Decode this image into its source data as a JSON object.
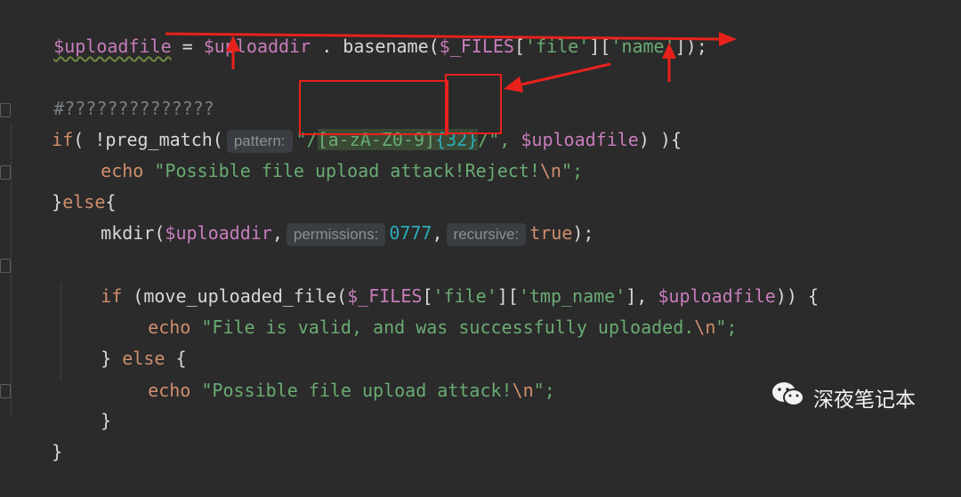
{
  "code": {
    "l1": {
      "var1": "$uploadfile",
      "eq": " = ",
      "var2": "$uploaddir",
      "dot": " . basename(",
      "var3": "$_FILES",
      "b1": "[",
      "s1": "'file'",
      "b2": "][",
      "s2": "'name'",
      "b3": "]);"
    },
    "l2": {
      "comment": "#??????????????"
    },
    "l3": {
      "kw": "if",
      "p1": "( !preg_match(",
      "hint": "pattern:",
      "q1": "\"/",
      "regex": "[a-zA-Z0-9]",
      "quant": "{32}",
      "q2": "/\", ",
      "var": "$uploadfile",
      "p2": ") ){"
    },
    "l4": {
      "kw": "echo",
      "s": " \"Possible file upload attack!Reject!",
      "esc": "\\n",
      "end": "\";"
    },
    "l5": {
      "brace": "}",
      "kw": "else",
      "brace2": "{"
    },
    "l6": {
      "fn": "mkdir(",
      "var": "$uploaddir",
      "comma": ",",
      "hint1": "permissions:",
      "num": "0777",
      "comma2": ",",
      "hint2": "recursive:",
      "kw": "true",
      "end": ");"
    },
    "l7": {
      "kw": "if",
      "p1": " (move_uploaded_file(",
      "var1": "$_FILES",
      "b1": "[",
      "s1": "'file'",
      "b2": "][",
      "s2": "'tmp_name'",
      "b3": "], ",
      "var2": "$uploadfile",
      "p2": ")) {"
    },
    "l8": {
      "kw": "echo",
      "s": " \"File is valid, and was successfully uploaded.",
      "esc": "\\n",
      "end": "\";"
    },
    "l9": {
      "brace": "} ",
      "kw": "else",
      "brace2": " {"
    },
    "l10": {
      "kw": "echo",
      "s": " \"Possible file upload attack!",
      "esc": "\\n",
      "end": "\";"
    },
    "l11": {
      "brace": "}"
    },
    "l12": {
      "brace": "}"
    }
  },
  "watermark": {
    "text": "深夜笔记本",
    "icon": "wechat-icon"
  },
  "colors": {
    "background": "#2b2b2b",
    "annotation": "#e8221b",
    "variable": "#c77dbb",
    "string": "#6aab73",
    "keyword": "#cf8e6d",
    "number": "#2aacb8"
  }
}
